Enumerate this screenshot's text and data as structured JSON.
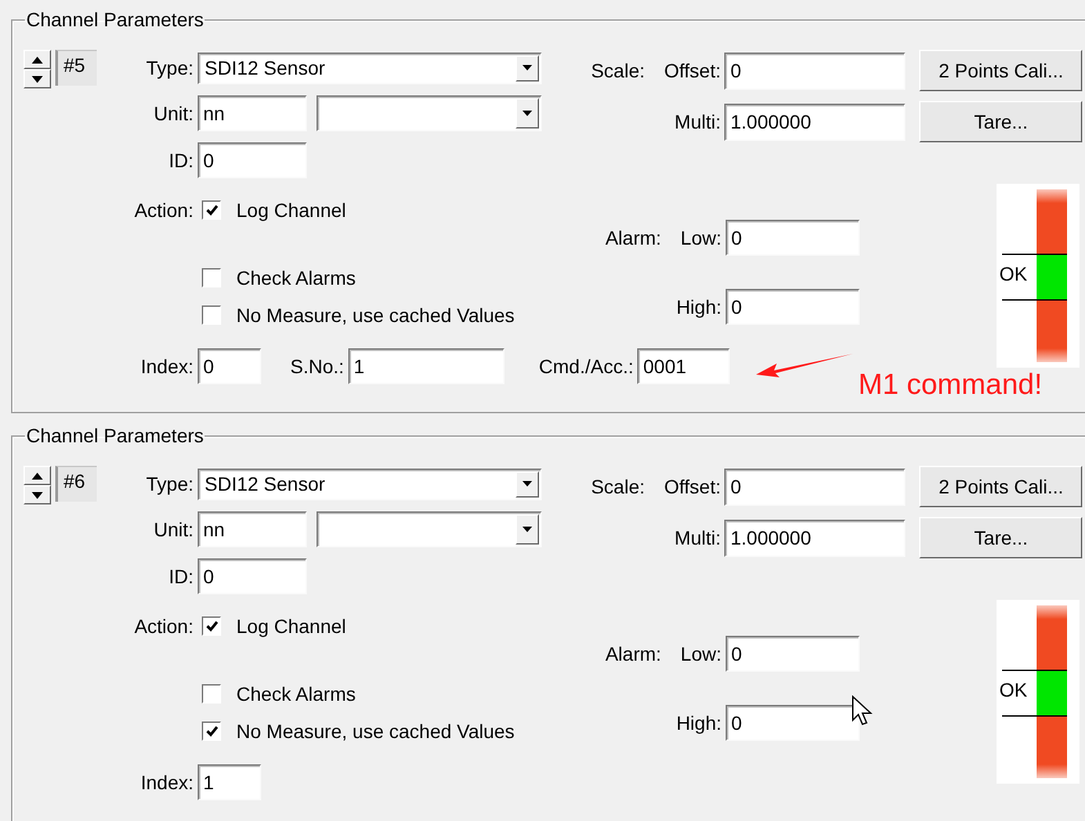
{
  "panels": [
    {
      "title": "Channel Parameters",
      "channel_number": "#5",
      "type": {
        "label": "Type:",
        "value": "SDI12 Sensor"
      },
      "unit": {
        "label": "Unit:",
        "value": "nn"
      },
      "id": {
        "label": "ID:",
        "value": "0"
      },
      "action_label": "Action:",
      "checkboxes": [
        {
          "label": "Log Channel",
          "checked": true
        },
        {
          "label": "Check Alarms",
          "checked": false
        },
        {
          "label": "No Measure, use cached Values",
          "checked": false
        }
      ],
      "scale_label": "Scale:",
      "offset": {
        "label": "Offset:",
        "value": "0"
      },
      "multi": {
        "label": "Multi:",
        "value": "1.000000"
      },
      "buttons": [
        "2 Points Cali...",
        "Tare..."
      ],
      "alarm_label": "Alarm:",
      "low": {
        "label": "Low:",
        "value": "0"
      },
      "high": {
        "label": "High:",
        "value": "0"
      },
      "indicator": {
        "label": "OK"
      },
      "index": {
        "label": "Index:",
        "value": "0"
      },
      "serial_no": {
        "label": "S.No.:",
        "value": "1"
      },
      "cmd": {
        "label": "Cmd./Acc.:",
        "value": "0001"
      },
      "annotation": {
        "text": "M1 command!"
      }
    },
    {
      "title": "Channel Parameters",
      "channel_number": "#6",
      "type": {
        "label": "Type:",
        "value": "SDI12 Sensor"
      },
      "unit": {
        "label": "Unit:",
        "value": "nn"
      },
      "id": {
        "label": "ID:",
        "value": "0"
      },
      "action_label": "Action:",
      "checkboxes": [
        {
          "label": "Log Channel",
          "checked": true
        },
        {
          "label": "Check Alarms",
          "checked": false
        },
        {
          "label": "No Measure, use cached Values",
          "checked": true
        }
      ],
      "scale_label": "Scale:",
      "offset": {
        "label": "Offset:",
        "value": "0"
      },
      "multi": {
        "label": "Multi:",
        "value": "1.000000"
      },
      "buttons": [
        "2 Points Cali...",
        "Tare..."
      ],
      "alarm_label": "Alarm:",
      "low": {
        "label": "Low:",
        "value": "0"
      },
      "high": {
        "label": "High:",
        "value": "0"
      },
      "indicator": {
        "label": "OK"
      },
      "index": {
        "label": "Index:",
        "value": "1"
      }
    }
  ]
}
